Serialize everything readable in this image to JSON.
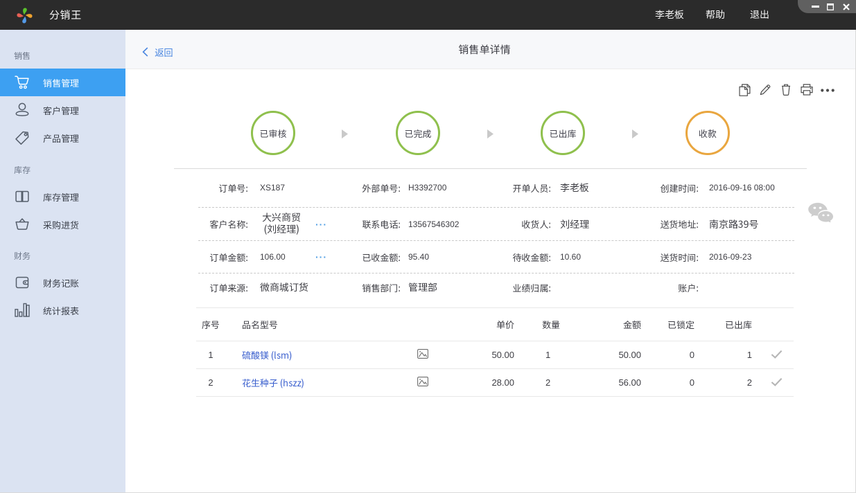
{
  "topbar": {
    "app_title": "分销王",
    "user": "李老板",
    "help": "帮助",
    "logout": "退出"
  },
  "sidebar": {
    "sections": [
      {
        "label": "销售",
        "items": [
          {
            "label": "销售管理"
          },
          {
            "label": "客户管理"
          },
          {
            "label": "产品管理"
          }
        ]
      },
      {
        "label": "库存",
        "items": [
          {
            "label": "库存管理"
          },
          {
            "label": "采购进货"
          }
        ]
      },
      {
        "label": "财务",
        "items": [
          {
            "label": "财务记账"
          },
          {
            "label": "统计报表"
          }
        ]
      }
    ]
  },
  "pagebar": {
    "back": "返回",
    "title": "销售单详情"
  },
  "steps": [
    {
      "label": "已审核",
      "color": "#8fc04d"
    },
    {
      "label": "已完成",
      "color": "#8fc04d"
    },
    {
      "label": "已出库",
      "color": "#8fc04d"
    },
    {
      "label": "收款",
      "color": "#e9a63f"
    }
  ],
  "details": {
    "rows": [
      [
        {
          "label": "订单号:",
          "value": "XS187"
        },
        {
          "label": "外部单号:",
          "value": "H3392700"
        },
        {
          "label": "开单人员:",
          "value": "李老板"
        },
        {
          "label": "创建时间:",
          "value": "2016-09-16 08:00"
        }
      ],
      [
        {
          "label": "客户名称:",
          "value": "大兴商贸",
          "value2": "(刘经理)",
          "more": "···"
        },
        {
          "label": "联系电话:",
          "value": "13567546302"
        },
        {
          "label": "收货人:",
          "value": "刘经理"
        },
        {
          "label": "送货地址:",
          "value": "南京路39号"
        }
      ],
      [
        {
          "label": "订单金额:",
          "value": "106.00",
          "more": "···"
        },
        {
          "label": "已收金额:",
          "value": "95.40"
        },
        {
          "label": "待收金额:",
          "value": "10.60"
        },
        {
          "label": "送货时间:",
          "value": "2016-09-23"
        }
      ],
      [
        {
          "label": "订单来源:",
          "value": "微商城订货"
        },
        {
          "label": "销售部门:",
          "value": "管理部"
        },
        {
          "label": "业绩归属:",
          "value": ""
        },
        {
          "label": "账户:",
          "value": ""
        }
      ]
    ]
  },
  "items_table": {
    "headers": {
      "index": "序号",
      "name": "品名型号",
      "price": "单价",
      "qty": "数量",
      "amount": "金额",
      "locked": "已锁定",
      "shipped": "已出库"
    },
    "rows": [
      {
        "index": "1",
        "name": "硫酸镁 (lsm)",
        "price": "50.00",
        "qty": "1",
        "amount": "50.00",
        "locked": "0",
        "shipped": "1"
      },
      {
        "index": "2",
        "name": "花生种子 (hszz)",
        "price": "28.00",
        "qty": "2",
        "amount": "56.00",
        "locked": "0",
        "shipped": "2"
      }
    ]
  },
  "colors": {
    "topbar_bg": "#2b2b2b",
    "sidebar_bg": "#dbe3f2",
    "active_item_bg": "#3da0f2",
    "step_done": "#8fc04d",
    "step_pending": "#e9a63f",
    "link_blue": "#4a86e0",
    "product_link": "#3a5fce"
  }
}
